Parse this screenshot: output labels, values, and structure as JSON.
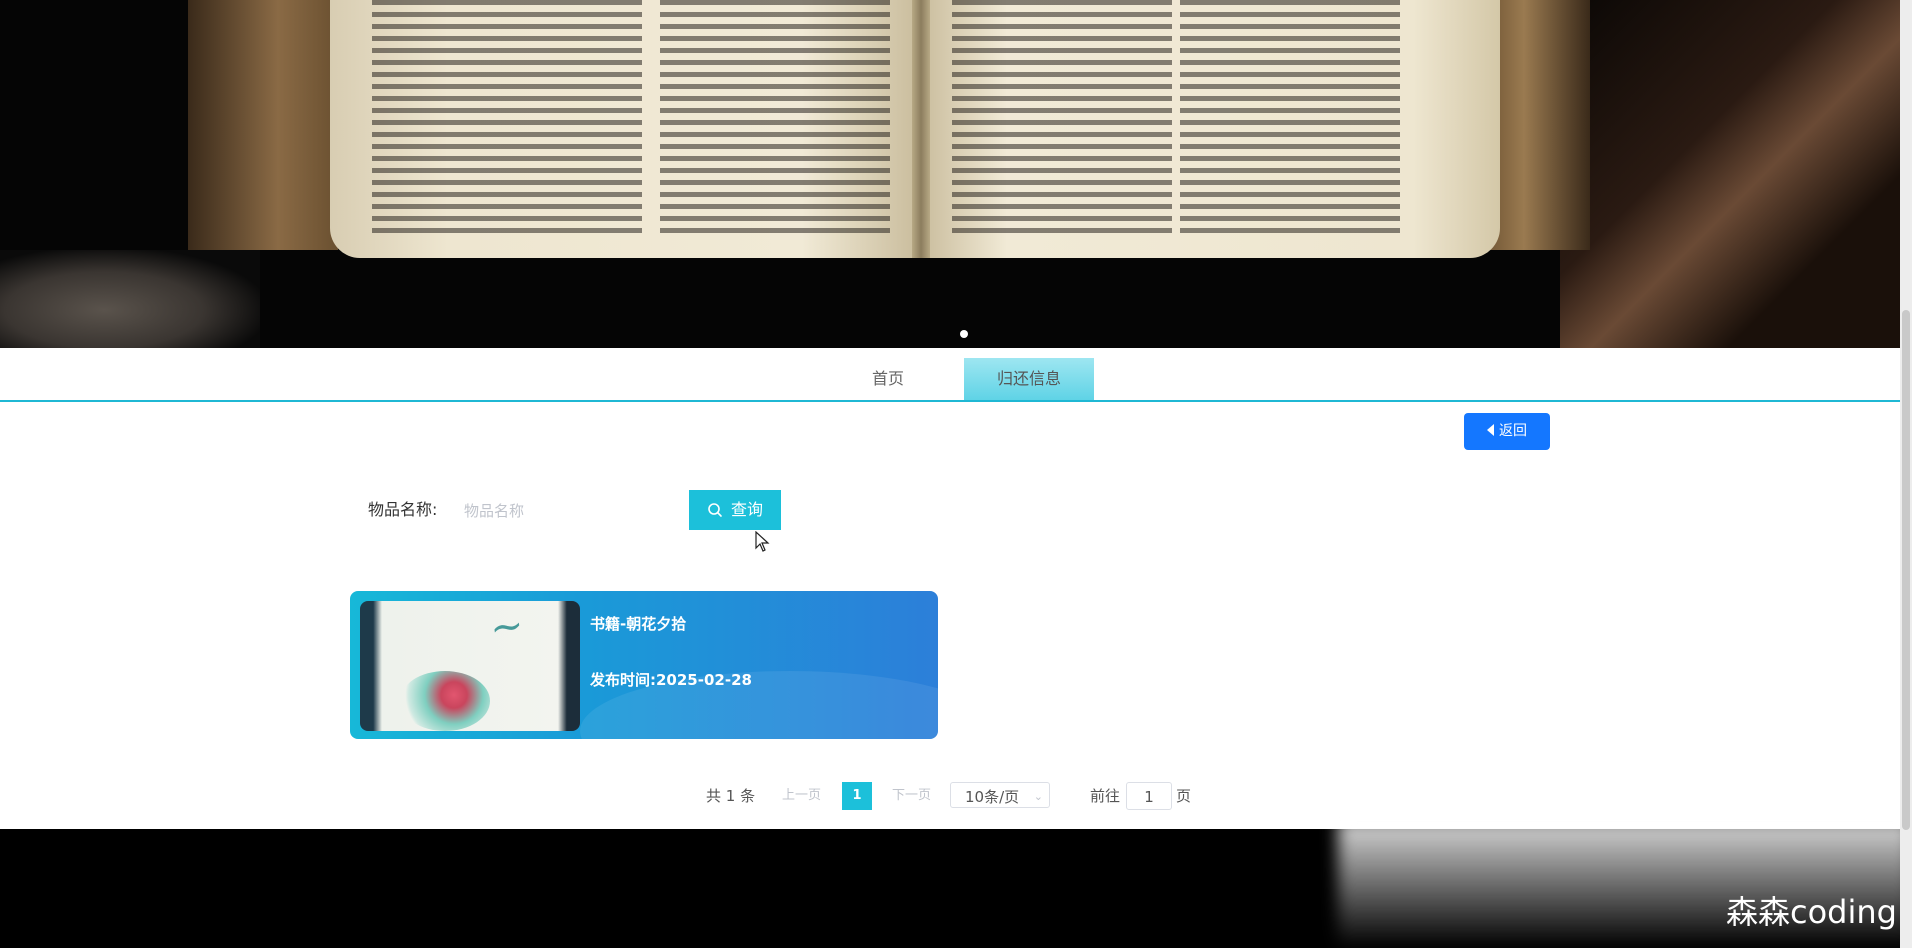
{
  "nav": {
    "tabs": [
      {
        "label": "首页"
      },
      {
        "label": "归还信息"
      }
    ]
  },
  "back_button": {
    "label": "返回"
  },
  "search": {
    "label": "物品名称:",
    "placeholder": "物品名称",
    "button_label": "查询"
  },
  "items": [
    {
      "title": "书籍-朝花夕拾",
      "date_label": "发布时间:",
      "date": "2025-02-28"
    }
  ],
  "pagination": {
    "total": "共 1 条",
    "prev": "上一页",
    "current": "1",
    "next": "下一页",
    "page_size": "10条/页",
    "goto_label": "前往",
    "goto_value": "1",
    "goto_unit": "页"
  },
  "watermark": "森森coding",
  "colors": {
    "accent": "#1cc0da",
    "back_button": "#1477ff",
    "card_gradient_start": "#17b8d8",
    "card_gradient_end": "#2c7fd9"
  },
  "icons": [
    "search-icon",
    "caret-left-icon",
    "chevron-down-icon",
    "mouse-cursor-icon"
  ]
}
